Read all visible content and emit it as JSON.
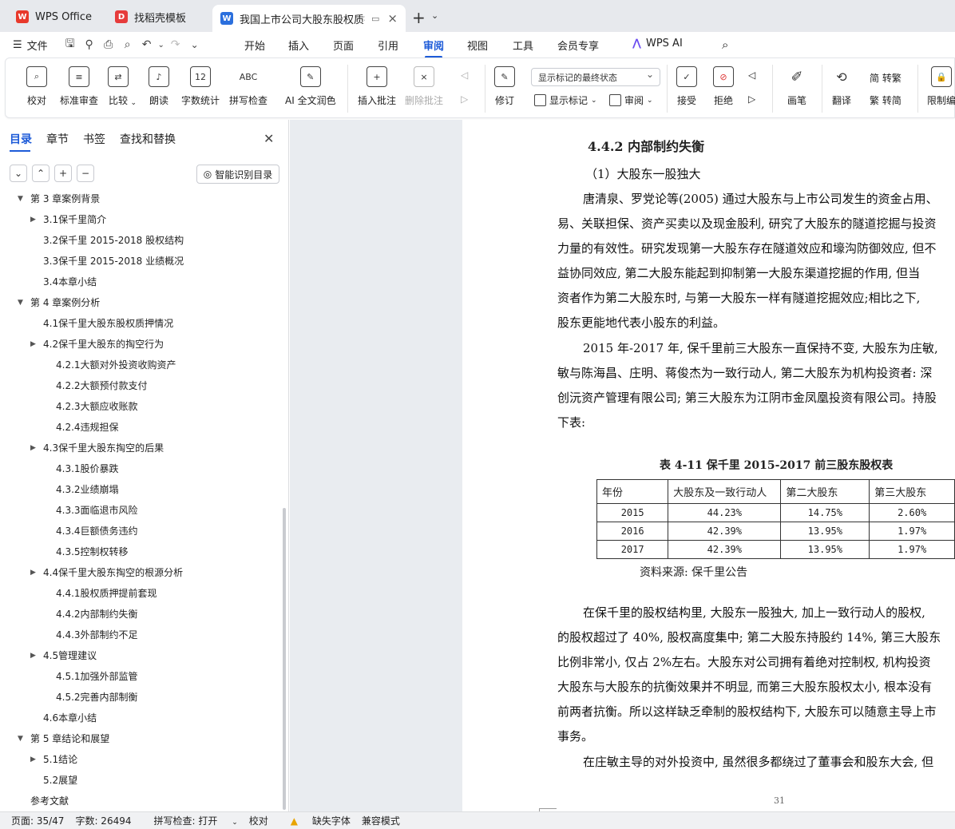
{
  "tabs": [
    {
      "label": "WPS Office",
      "icon": "wps-logo-icon",
      "color": "#e8392b"
    },
    {
      "label": "找稻壳模板",
      "icon": "docer-icon",
      "color": "#e63b3b"
    },
    {
      "label": "我国上市公司大股东股权质押",
      "icon": "word-doc-icon",
      "color": "#2b6fdd"
    }
  ],
  "menu": {
    "file": "文件",
    "tabs": [
      "开始",
      "插入",
      "页面",
      "引用",
      "审阅",
      "视图",
      "工具",
      "会员专享",
      "WPS AI"
    ],
    "active": "审阅"
  },
  "ribbon": {
    "proofread": "校对",
    "std_review": "标准审查",
    "compare": "比较",
    "read_aloud": "朗读",
    "word_count": "字数统计",
    "spell_check": "拼写检查",
    "ai_polish": "AI 全文润色",
    "insert_comment": "插入批注",
    "delete_comment": "删除批注",
    "track_changes": "修订",
    "display_mode": "显示标记的最终状态",
    "show_markup": "显示标记",
    "review_pane": "审阅",
    "accept": "接受",
    "reject": "拒绝",
    "pen": "画笔",
    "translate": "翻译",
    "to_traditional": "简 转繁",
    "to_simplified": "繁 转简",
    "restrict_edit": "限制编",
    "word_count_icon_text": "12",
    "spell_icon_text": "ABC"
  },
  "sidebar": {
    "tabs": [
      "目录",
      "章节",
      "书签",
      "查找和替换"
    ],
    "smart_btn": "智能识别目录",
    "toc": [
      {
        "label": "第 3 章案例背景",
        "level": 0,
        "arrow": "▼"
      },
      {
        "label": "3.1保千里简介",
        "level": 1,
        "arrow": "▶"
      },
      {
        "label": "3.2保千里 2015-2018 股权结构",
        "level": 1,
        "arrow": ""
      },
      {
        "label": "3.3保千里 2015-2018 业绩概况",
        "level": 1,
        "arrow": ""
      },
      {
        "label": "3.4本章小结",
        "level": 1,
        "arrow": ""
      },
      {
        "label": "第 4 章案例分析",
        "level": 0,
        "arrow": "▼"
      },
      {
        "label": "4.1保千里大股东股权质押情况",
        "level": 1,
        "arrow": ""
      },
      {
        "label": "4.2保千里大股东的掏空行为",
        "level": 1,
        "arrow": "▶"
      },
      {
        "label": "4.2.1大额对外投资收购资产",
        "level": 2,
        "arrow": ""
      },
      {
        "label": "4.2.2大额预付款支付",
        "level": 2,
        "arrow": ""
      },
      {
        "label": "4.2.3大额应收账款",
        "level": 2,
        "arrow": ""
      },
      {
        "label": "4.2.4违规担保",
        "level": 2,
        "arrow": ""
      },
      {
        "label": "4.3保千里大股东掏空的后果",
        "level": 1,
        "arrow": "▶"
      },
      {
        "label": "4.3.1股价暴跌",
        "level": 2,
        "arrow": ""
      },
      {
        "label": "4.3.2业绩崩塌",
        "level": 2,
        "arrow": ""
      },
      {
        "label": "4.3.3面临退市风险",
        "level": 2,
        "arrow": ""
      },
      {
        "label": "4.3.4巨额债务违约",
        "level": 2,
        "arrow": ""
      },
      {
        "label": "4.3.5控制权转移",
        "level": 2,
        "arrow": ""
      },
      {
        "label": "4.4保千里大股东掏空的根源分析",
        "level": 1,
        "arrow": "▶"
      },
      {
        "label": "4.4.1股权质押提前套现",
        "level": 2,
        "arrow": ""
      },
      {
        "label": "4.4.2内部制约失衡",
        "level": 2,
        "arrow": ""
      },
      {
        "label": "4.4.3外部制约不足",
        "level": 2,
        "arrow": ""
      },
      {
        "label": "4.5管理建议",
        "level": 1,
        "arrow": "▶"
      },
      {
        "label": "4.5.1加强外部监管",
        "level": 2,
        "arrow": ""
      },
      {
        "label": "4.5.2完善内部制衡",
        "level": 2,
        "arrow": ""
      },
      {
        "label": "4.6本章小结",
        "level": 1,
        "arrow": ""
      },
      {
        "label": "第 5 章结论和展望",
        "level": 0,
        "arrow": "▼"
      },
      {
        "label": "5.1结论",
        "level": 1,
        "arrow": "▶"
      },
      {
        "label": "5.2展望",
        "level": 1,
        "arrow": ""
      },
      {
        "label": "参考文献",
        "level": 0,
        "arrow": ""
      }
    ]
  },
  "doc": {
    "heading": "4.4.2  内部制约失衡",
    "sub": "（1）大股东一股独大",
    "p1": [
      "唐清泉、罗党论等(2005) 通过大股东与上市公司发生的资金占用、",
      "易、关联担保、资产买卖以及现金股利, 研究了大股东的隧道挖掘与投资",
      "力量的有效性。研究发现第一大股东存在隧道效应和壕沟防御效应, 但不",
      "益协同效应, 第二大股东能起到抑制第一大股东渠道挖掘的作用, 但当",
      "资者作为第二大股东时, 与第一大股东一样有隧道挖掘效应;相比之下,",
      "股东更能地代表小股东的利益。"
    ],
    "p2": [
      "2015 年-2017 年, 保千里前三大股东一直保持不变, 大股东为庄敏,",
      "敏与陈海昌、庄明、蒋俊杰为一致行动人, 第二大股东为机构投资者: 深",
      "创沅资产管理有限公司; 第三大股东为江阴市金凤凰投资有限公司。持股",
      "下表:"
    ],
    "table_caption": "表 4-11  保千里 2015-2017 前三股东股权表",
    "table_head": [
      "年份",
      "大股东及一致行动人",
      "第二大股东",
      "第三大股东"
    ],
    "table_rows": [
      [
        "2015",
        "44.23%",
        "14.75%",
        "2.60%"
      ],
      [
        "2016",
        "42.39%",
        "13.95%",
        "1.97%"
      ],
      [
        "2017",
        "42.39%",
        "13.95%",
        "1.97%"
      ]
    ],
    "source": "资料来源: 保千里公告",
    "p3": [
      "在保千里的股权结构里, 大股东一股独大, 加上一致行动人的股权,",
      "的股权超过了 40%, 股权高度集中; 第二大股东持股约 14%, 第三大股东",
      "比例非常小, 仅占 2%左右。大股东对公司拥有着绝对控制权, 机构投资",
      "大股东与大股东的抗衡效果并不明显, 而第三大股东股权太小, 根本没有",
      "前两者抗衡。所以这样缺乏牵制的股权结构下, 大股东可以随意主导上市",
      "事务。"
    ],
    "p4": "在庄敏主导的对外投资中, 虽然很多都绕过了董事会和股东大会, 但",
    "page_number": "31"
  },
  "status": {
    "page": "页面: 35/47",
    "words": "字数: 26494",
    "spell": "拼写检查: 打开",
    "proof": "校对",
    "missing_font": "缺失字体",
    "compat": "兼容模式"
  }
}
